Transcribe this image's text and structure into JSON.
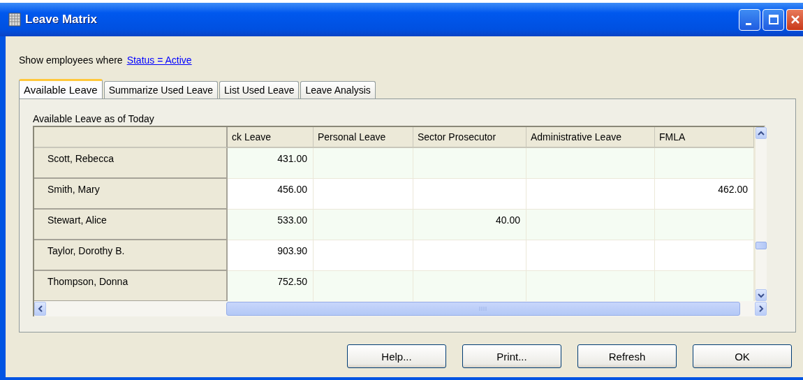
{
  "window": {
    "title": "Leave Matrix"
  },
  "filter": {
    "label": "Show employees where",
    "link": "Status = Active"
  },
  "tabs": [
    {
      "label": "Available Leave",
      "selected": true
    },
    {
      "label": "Summarize Used Leave",
      "selected": false
    },
    {
      "label": "List Used Leave",
      "selected": false
    },
    {
      "label": "Leave Analysis",
      "selected": false
    }
  ],
  "panel": {
    "caption": "Available Leave as of Today"
  },
  "table": {
    "columns": [
      "ck Leave",
      "Personal Leave",
      "Sector Prosecutor",
      "Administrative Leave",
      "FMLA"
    ],
    "rows": [
      {
        "name": "Scott, Rebecca",
        "values": {
          "column_2": "431.00"
        }
      },
      {
        "name": "Smith, Mary",
        "values": {
          "column_2": "456.00",
          "column_6": "462.00"
        }
      },
      {
        "name": "Stewart, Alice",
        "values": {
          "column_2": "533.00",
          "column_4": "40.00"
        }
      },
      {
        "name": "Taylor, Dorothy B.",
        "values": {
          "column_2": "903.90"
        }
      },
      {
        "name": "Thompson, Donna",
        "values": {
          "column_2": "752.50"
        }
      }
    ]
  },
  "buttons": [
    "Help...",
    "Print...",
    "Refresh",
    "OK"
  ]
}
